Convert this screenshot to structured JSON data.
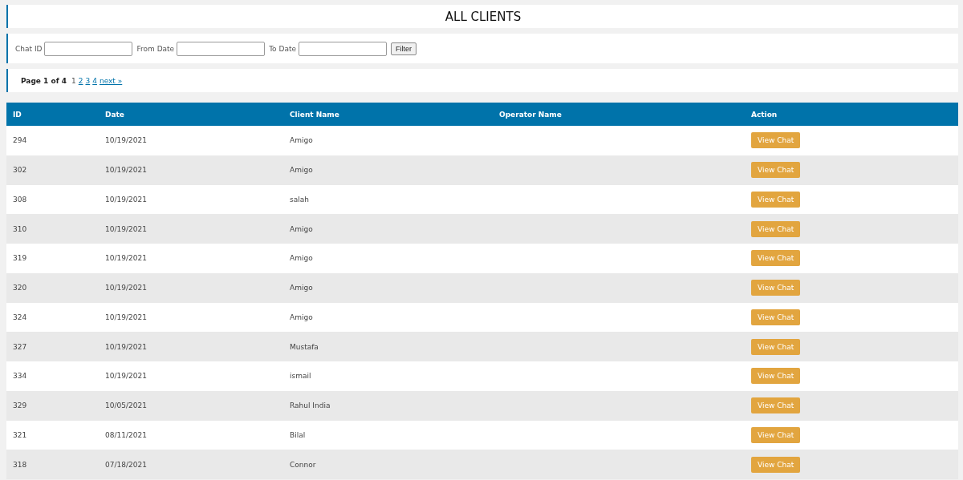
{
  "title": "ALL CLIENTS",
  "filters": [
    {
      "label": "Chat ID"
    },
    {
      "label": "From Date"
    },
    {
      "label": "To Date"
    }
  ],
  "filter_button": "Filter",
  "pagination": {
    "summary": "Page 1 of 4",
    "pages": [
      {
        "label": "1",
        "selected": true
      },
      {
        "label": "2",
        "selected": false
      },
      {
        "label": "3",
        "selected": false
      },
      {
        "label": "4",
        "selected": false
      }
    ],
    "next": "next »"
  },
  "table": {
    "columns": [
      "ID",
      "Date",
      "Client Name",
      "Operator Name",
      "Action"
    ],
    "rows": [
      {
        "id": "294",
        "date": "10/19/2021",
        "client": "Amigo",
        "action": "View Chat"
      },
      {
        "id": "302",
        "date": "10/19/2021",
        "client": "Amigo",
        "action": "View Chat"
      },
      {
        "id": "308",
        "date": "10/19/2021",
        "client": "salah",
        "action": "View Chat"
      },
      {
        "id": "310",
        "date": "10/19/2021",
        "client": "Amigo",
        "action": "View Chat"
      },
      {
        "id": "319",
        "date": "10/19/2021",
        "client": "Amigo",
        "action": "View Chat"
      },
      {
        "id": "320",
        "date": "10/19/2021",
        "client": "Amigo",
        "action": "View Chat"
      },
      {
        "id": "324",
        "date": "10/19/2021",
        "client": "Amigo",
        "action": "View Chat"
      },
      {
        "id": "327",
        "date": "10/19/2021",
        "client": "Mustafa",
        "action": "View Chat"
      },
      {
        "id": "334",
        "date": "10/19/2021",
        "client": "ismail",
        "action": "View Chat"
      },
      {
        "id": "329",
        "date": "10/05/2021",
        "client": "Rahul India",
        "action": "View Chat"
      },
      {
        "id": "321",
        "date": "08/11/2021",
        "client": "Bilal",
        "action": "View Chat"
      },
      {
        "id": "318",
        "date": "07/18/2021",
        "client": "Connor",
        "action": "View Chat"
      }
    ]
  }
}
